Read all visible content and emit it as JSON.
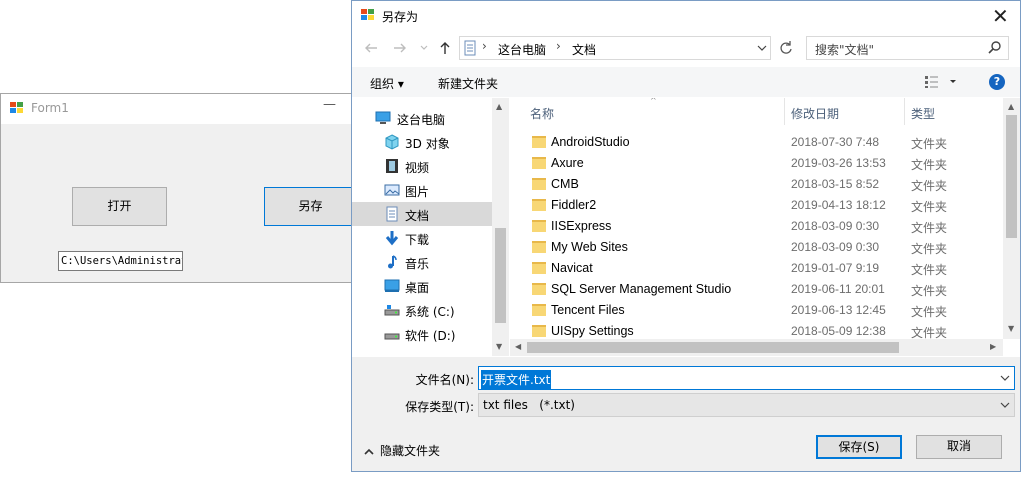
{
  "form1": {
    "title": "Form1",
    "minimize": "—",
    "open_label": "打开",
    "saveas_label": "另存",
    "path_value": "C:\\Users\\Administrat"
  },
  "dialog": {
    "title": "另存为",
    "close": "✕",
    "address": {
      "sep1": "›",
      "crumb1": "这台电脑",
      "sep2": "›",
      "crumb2": "文档"
    },
    "search_placeholder": "搜索\"文档\"",
    "toolbar": {
      "organize": "组织 ▾",
      "new_folder": "新建文件夹",
      "help": "?"
    },
    "tree": [
      {
        "label": "这台电脑",
        "icon": "computer-icon"
      },
      {
        "label": "3D 对象",
        "icon": "3d-objects-icon"
      },
      {
        "label": "视频",
        "icon": "video-icon"
      },
      {
        "label": "图片",
        "icon": "pictures-icon"
      },
      {
        "label": "文档",
        "icon": "documents-icon"
      },
      {
        "label": "下载",
        "icon": "download-icon"
      },
      {
        "label": "音乐",
        "icon": "music-icon"
      },
      {
        "label": "桌面",
        "icon": "desktop-icon"
      },
      {
        "label": "系统 (C:)",
        "icon": "drive-icon"
      },
      {
        "label": "软件 (D:)",
        "icon": "drive-icon"
      }
    ],
    "columns": {
      "name": "名称",
      "date": "修改日期",
      "type": "类型"
    },
    "files": [
      {
        "name": "AndroidStudio",
        "date": "2018-07-30 7:48",
        "type": "文件夹"
      },
      {
        "name": "Axure",
        "date": "2019-03-26 13:53",
        "type": "文件夹"
      },
      {
        "name": "CMB",
        "date": "2018-03-15 8:52",
        "type": "文件夹"
      },
      {
        "name": "Fiddler2",
        "date": "2019-04-13 18:12",
        "type": "文件夹"
      },
      {
        "name": "IISExpress",
        "date": "2018-03-09 0:30",
        "type": "文件夹"
      },
      {
        "name": "My Web Sites",
        "date": "2018-03-09 0:30",
        "type": "文件夹"
      },
      {
        "name": "Navicat",
        "date": "2019-01-07 9:19",
        "type": "文件夹"
      },
      {
        "name": "SQL Server Management Studio",
        "date": "2019-06-11 20:01",
        "type": "文件夹"
      },
      {
        "name": "Tencent Files",
        "date": "2019-06-13 12:45",
        "type": "文件夹"
      },
      {
        "name": "UISpy Settings",
        "date": "2018-05-09 12:38",
        "type": "文件夹"
      }
    ],
    "filename_label": "文件名(N):",
    "filename_value": "开票文件.txt",
    "filetype_label": "保存类型(T):",
    "filetype_value": "txt files   (*.txt)",
    "hide_folders": "隐藏文件夹",
    "save_label": "保存(S)",
    "cancel_label": "取消"
  },
  "colors": {
    "accent": "#0078d7",
    "folder": "#f8d775",
    "selected": "#d9d9d9"
  }
}
